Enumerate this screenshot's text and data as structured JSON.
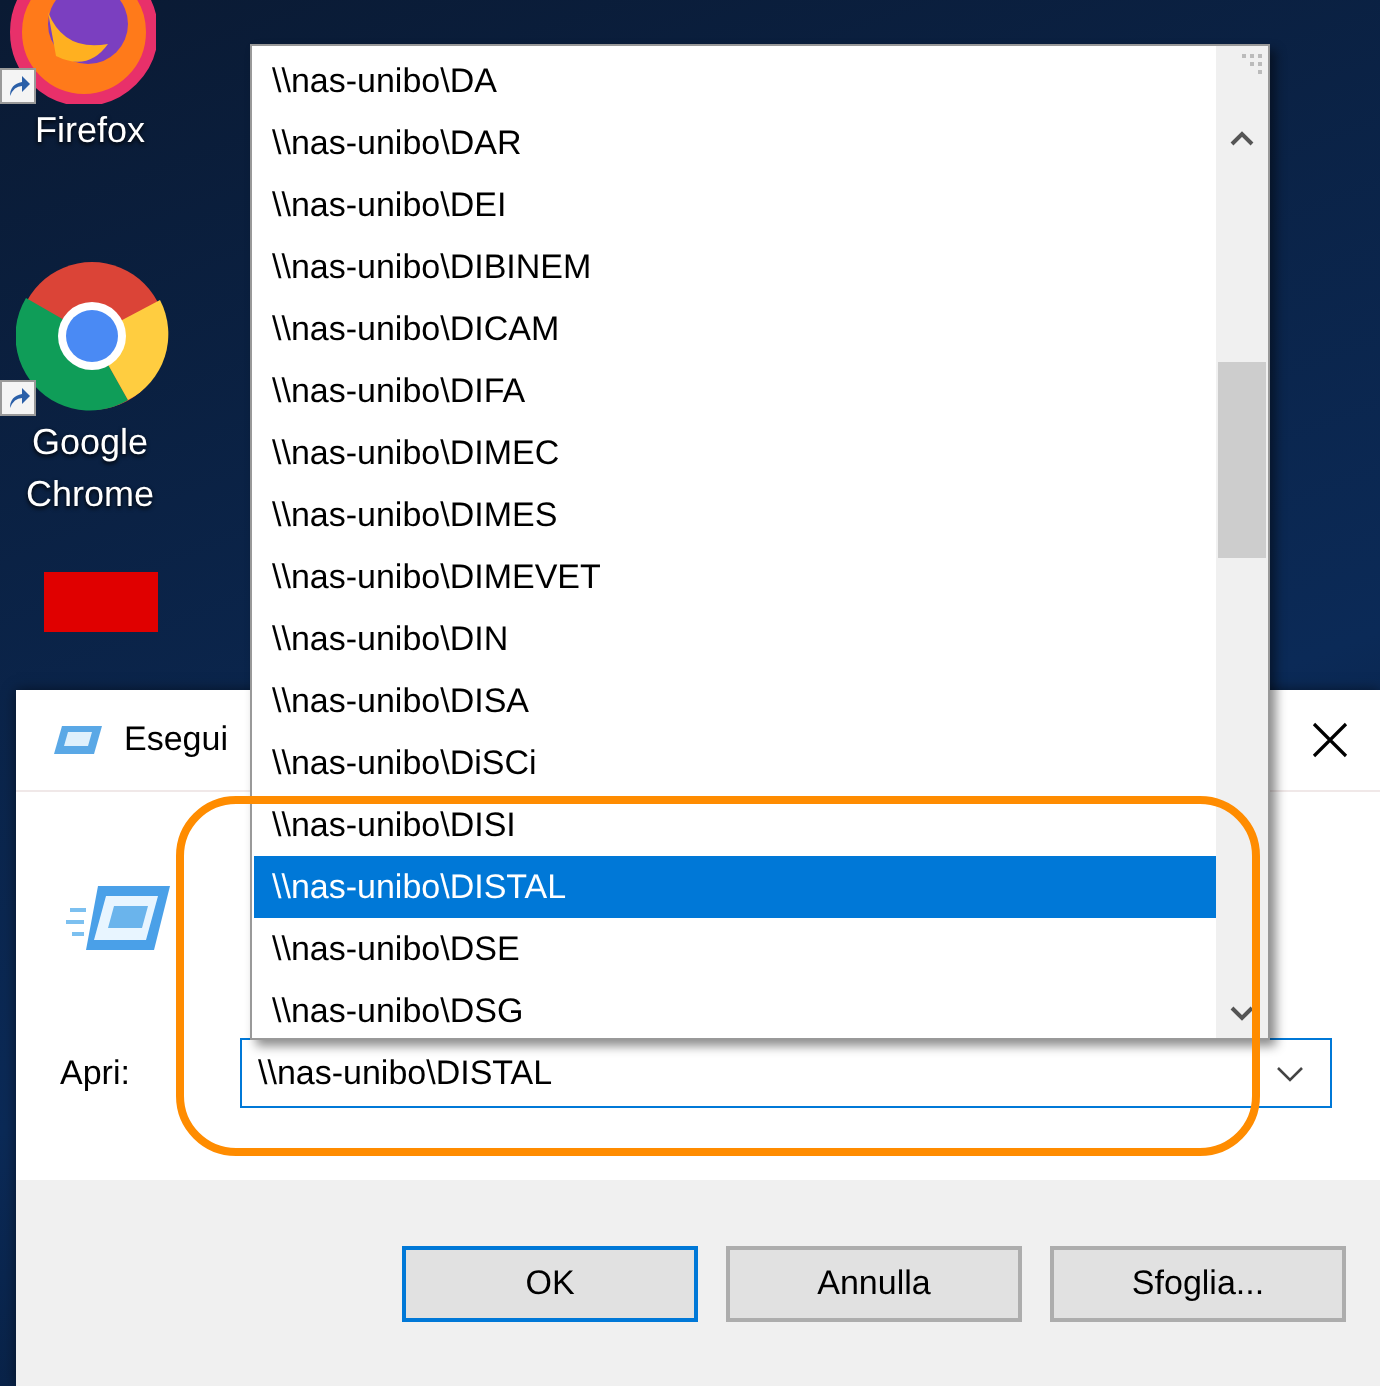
{
  "desktop": {
    "icons": [
      {
        "label": "Firefox",
        "kind": "firefox"
      },
      {
        "label": "Google Chrome",
        "kind": "chrome"
      },
      {
        "kind": "red"
      }
    ]
  },
  "dialog": {
    "title": "Esegui",
    "open_label": "Apri:",
    "open_value": "\\\\nas-unibo\\DISTAL",
    "buttons": [
      {
        "label": "OK",
        "default": true
      },
      {
        "label": "Annulla",
        "default": false
      },
      {
        "label": "Sfoglia...",
        "default": false
      }
    ]
  },
  "dropdown": {
    "items": [
      {
        "label": "\\\\nas-unibo\\DA",
        "selected": false
      },
      {
        "label": "\\\\nas-unibo\\DAR",
        "selected": false
      },
      {
        "label": "\\\\nas-unibo\\DEI",
        "selected": false
      },
      {
        "label": "\\\\nas-unibo\\DIBINEM",
        "selected": false
      },
      {
        "label": "\\\\nas-unibo\\DICAM",
        "selected": false
      },
      {
        "label": "\\\\nas-unibo\\DIFA",
        "selected": false
      },
      {
        "label": "\\\\nas-unibo\\DIMEC",
        "selected": false
      },
      {
        "label": "\\\\nas-unibo\\DIMES",
        "selected": false
      },
      {
        "label": "\\\\nas-unibo\\DIMEVET",
        "selected": false
      },
      {
        "label": "\\\\nas-unibo\\DIN",
        "selected": false
      },
      {
        "label": "\\\\nas-unibo\\DISA",
        "selected": false
      },
      {
        "label": "\\\\nas-unibo\\DiSCi",
        "selected": false
      },
      {
        "label": "\\\\nas-unibo\\DISI",
        "selected": false
      },
      {
        "label": "\\\\nas-unibo\\DISTAL",
        "selected": true
      },
      {
        "label": "\\\\nas-unibo\\DSE",
        "selected": false
      },
      {
        "label": "\\\\nas-unibo\\DSG",
        "selected": false
      }
    ]
  },
  "annotation": {
    "kind": "rounded-outline",
    "color": "#ff8c00"
  }
}
